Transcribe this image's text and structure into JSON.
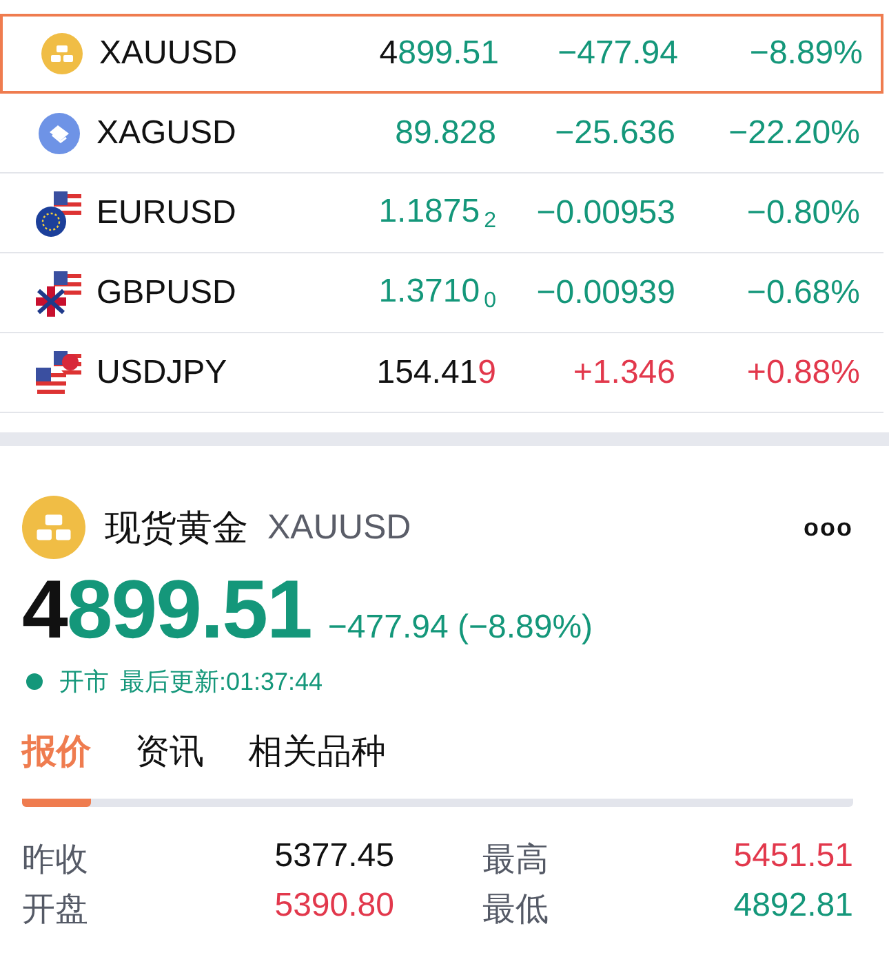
{
  "quotes": [
    {
      "symbol": "XAUUSD",
      "selected": true,
      "price": [
        {
          "text": "4",
          "color": "#111111"
        },
        {
          "text": "899.51",
          "color": "#14977a"
        }
      ],
      "change": "−477.94",
      "change_pct": "−8.89%",
      "color": "#14977a"
    },
    {
      "symbol": "XAGUSD",
      "selected": false,
      "price": [
        {
          "text": "89.828",
          "color": "#14977a"
        }
      ],
      "change": "−25.636",
      "change_pct": "−22.20%",
      "color": "#14977a"
    },
    {
      "symbol": "EURUSD",
      "selected": false,
      "price": [
        {
          "text": "1.1875",
          "color": "#14977a"
        }
      ],
      "price_sub": "2",
      "change": "−0.00953",
      "change_pct": "−0.80%",
      "color": "#14977a"
    },
    {
      "symbol": "GBPUSD",
      "selected": false,
      "price": [
        {
          "text": "1.3710",
          "color": "#14977a"
        }
      ],
      "price_sub": "0",
      "change": "−0.00939",
      "change_pct": "−0.68%",
      "color": "#14977a"
    },
    {
      "symbol": "USDJPY",
      "selected": false,
      "price": [
        {
          "text": "154.41",
          "color": "#111111"
        },
        {
          "text": "9",
          "color": "#e2384c"
        }
      ],
      "change": "+1.346",
      "change_pct": "+0.88%",
      "color": "#e2384c"
    }
  ],
  "detail": {
    "name": "现货黄金",
    "symbol": "XAUUSD",
    "more": "ooo",
    "price": [
      {
        "text": "4",
        "color": "#111111"
      },
      {
        "text": "899.51",
        "color": "#14977a"
      }
    ],
    "change": "−477.94 (−8.89%)",
    "color": "#14977a",
    "market_status": "开市",
    "updated": "最后更新:01:37:44"
  },
  "tabs": [
    {
      "label": "报价",
      "selected": true
    },
    {
      "label": "资讯",
      "selected": false
    },
    {
      "label": "相关品种",
      "selected": false
    }
  ],
  "stats": [
    {
      "label": "昨收",
      "value": "5377.45",
      "color": "#111111"
    },
    {
      "label": "最高",
      "value": "5451.51",
      "color": "#e2384c"
    },
    {
      "label": "开盘",
      "value": "5390.80",
      "color": "#e2384c"
    },
    {
      "label": "最低",
      "value": "4892.81",
      "color": "#14977a"
    }
  ]
}
